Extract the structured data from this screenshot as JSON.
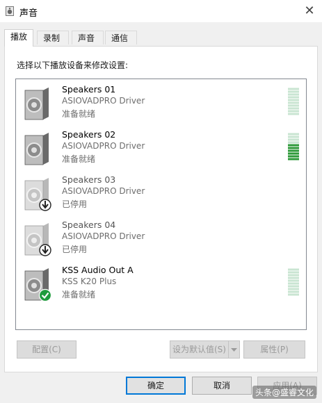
{
  "window": {
    "title": "声音"
  },
  "tabs": [
    {
      "label": "播放",
      "active": true
    },
    {
      "label": "录制",
      "active": false
    },
    {
      "label": "声音",
      "active": false
    },
    {
      "label": "通信",
      "active": false
    }
  ],
  "instruction": "选择以下播放设备来修改设置:",
  "devices": [
    {
      "name": "Speakers 01",
      "driver": "ASIOVADPRO Driver",
      "status": "准备就绪",
      "state": "ready",
      "meter_level": 0
    },
    {
      "name": "Speakers 02",
      "driver": "ASIOVADPRO Driver",
      "status": "准备就绪",
      "state": "ready",
      "meter_level": 0.6
    },
    {
      "name": "Speakers 03",
      "driver": "ASIOVADPRO Driver",
      "status": "已停用",
      "state": "disabled"
    },
    {
      "name": "Speakers 04",
      "driver": "ASIOVADPRO Driver",
      "status": "已停用",
      "state": "disabled"
    },
    {
      "name": "KSS Audio Out A",
      "driver": "KSS K20 Plus",
      "status": "准备就绪",
      "state": "default",
      "meter_level": 0
    }
  ],
  "buttons": {
    "configure": "配置(C)",
    "set_default": "设为默认值(S)",
    "properties": "属性(P)",
    "ok": "确定",
    "cancel": "取消",
    "apply": "应用(A)"
  },
  "watermark": "头条@盛睿文化",
  "colors": {
    "meter_active": "#2e9a3a",
    "meter_inactive": "#c9e5d2",
    "default_badge": "#1e9b3c",
    "focus_border": "#0078d7"
  }
}
